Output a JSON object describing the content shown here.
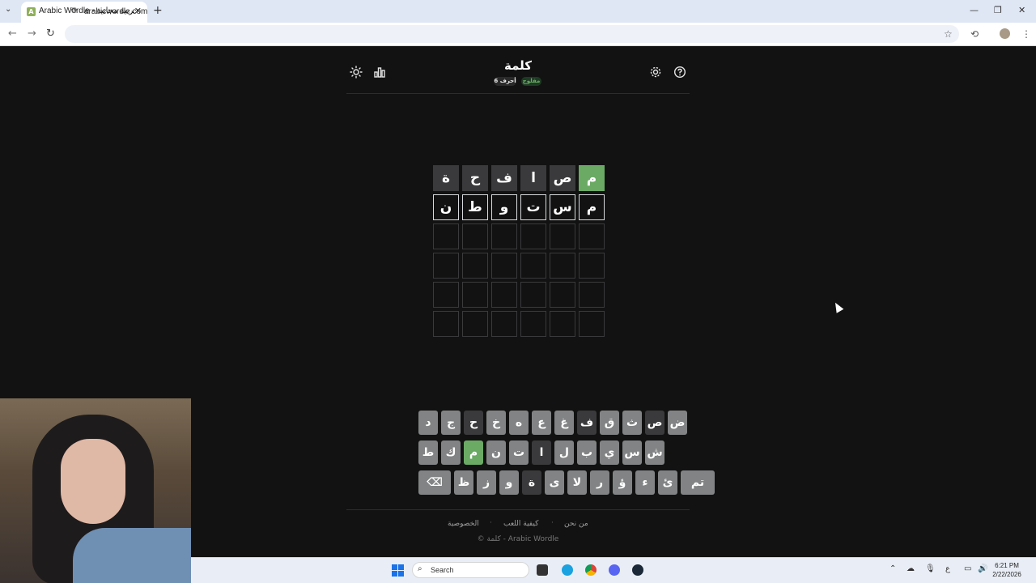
{
  "browser": {
    "tab_title": "Arabic Wordle - ألغاز عربية مجانية",
    "url": "arabicwordle.com",
    "new_tab": "+",
    "close": "✕",
    "minimize": "—",
    "restore": "❐",
    "close_window": "✕"
  },
  "game": {
    "title": "كلمة",
    "mode_badge": "مقلوج",
    "length_badge": "6 أحرف"
  },
  "board": {
    "rows": [
      [
        {
          "letter": "م",
          "state": "correct"
        },
        {
          "letter": "ص",
          "state": "absent"
        },
        {
          "letter": "ا",
          "state": "absent"
        },
        {
          "letter": "ف",
          "state": "absent"
        },
        {
          "letter": "ح",
          "state": "absent"
        },
        {
          "letter": "ة",
          "state": "absent"
        }
      ],
      [
        {
          "letter": "م",
          "state": "filled"
        },
        {
          "letter": "س",
          "state": "filled"
        },
        {
          "letter": "ت",
          "state": "filled"
        },
        {
          "letter": "و",
          "state": "filled"
        },
        {
          "letter": "ط",
          "state": "filled"
        },
        {
          "letter": "ن",
          "state": "filled"
        }
      ],
      [
        {
          "letter": "",
          "state": "empty"
        },
        {
          "letter": "",
          "state": "empty"
        },
        {
          "letter": "",
          "state": "empty"
        },
        {
          "letter": "",
          "state": "empty"
        },
        {
          "letter": "",
          "state": "empty"
        },
        {
          "letter": "",
          "state": "empty"
        }
      ],
      [
        {
          "letter": "",
          "state": "empty"
        },
        {
          "letter": "",
          "state": "empty"
        },
        {
          "letter": "",
          "state": "empty"
        },
        {
          "letter": "",
          "state": "empty"
        },
        {
          "letter": "",
          "state": "empty"
        },
        {
          "letter": "",
          "state": "empty"
        }
      ],
      [
        {
          "letter": "",
          "state": "empty"
        },
        {
          "letter": "",
          "state": "empty"
        },
        {
          "letter": "",
          "state": "empty"
        },
        {
          "letter": "",
          "state": "empty"
        },
        {
          "letter": "",
          "state": "empty"
        },
        {
          "letter": "",
          "state": "empty"
        }
      ],
      [
        {
          "letter": "",
          "state": "empty"
        },
        {
          "letter": "",
          "state": "empty"
        },
        {
          "letter": "",
          "state": "empty"
        },
        {
          "letter": "",
          "state": "empty"
        },
        {
          "letter": "",
          "state": "empty"
        },
        {
          "letter": "",
          "state": "empty"
        }
      ]
    ]
  },
  "keyboard": {
    "row1": [
      {
        "k": "ض",
        "s": ""
      },
      {
        "k": "ص",
        "s": "absent"
      },
      {
        "k": "ث",
        "s": ""
      },
      {
        "k": "ق",
        "s": ""
      },
      {
        "k": "ف",
        "s": "absent"
      },
      {
        "k": "غ",
        "s": ""
      },
      {
        "k": "ع",
        "s": ""
      },
      {
        "k": "ه",
        "s": ""
      },
      {
        "k": "خ",
        "s": ""
      },
      {
        "k": "ح",
        "s": "absent"
      },
      {
        "k": "ج",
        "s": ""
      },
      {
        "k": "د",
        "s": ""
      }
    ],
    "row2": [
      {
        "k": "ش",
        "s": ""
      },
      {
        "k": "س",
        "s": ""
      },
      {
        "k": "ي",
        "s": ""
      },
      {
        "k": "ب",
        "s": ""
      },
      {
        "k": "ل",
        "s": ""
      },
      {
        "k": "ا",
        "s": "absent"
      },
      {
        "k": "ت",
        "s": ""
      },
      {
        "k": "ن",
        "s": ""
      },
      {
        "k": "م",
        "s": "correct"
      },
      {
        "k": "ك",
        "s": ""
      },
      {
        "k": "ط",
        "s": ""
      }
    ],
    "row3": [
      {
        "k": "تم",
        "s": "wide"
      },
      {
        "k": "ئ",
        "s": ""
      },
      {
        "k": "ء",
        "s": ""
      },
      {
        "k": "ؤ",
        "s": ""
      },
      {
        "k": "ر",
        "s": ""
      },
      {
        "k": "لا",
        "s": ""
      },
      {
        "k": "ى",
        "s": ""
      },
      {
        "k": "ة",
        "s": "absent"
      },
      {
        "k": "و",
        "s": ""
      },
      {
        "k": "ز",
        "s": ""
      },
      {
        "k": "ظ",
        "s": ""
      },
      {
        "k": "⌫",
        "s": "del"
      }
    ]
  },
  "footer": {
    "about": "من نحن",
    "how_to_play": "كيفية اللعب",
    "privacy": "الخصوصية",
    "separator": "·",
    "copyright": "© كلمة - Arabic Wordle"
  },
  "taskbar": {
    "search_placeholder": "Search",
    "time": "6:21 PM",
    "date": "2/22/2026"
  },
  "colors": {
    "correct": "#6aaa64",
    "absent": "#3a3a3c",
    "background": "#121212"
  }
}
